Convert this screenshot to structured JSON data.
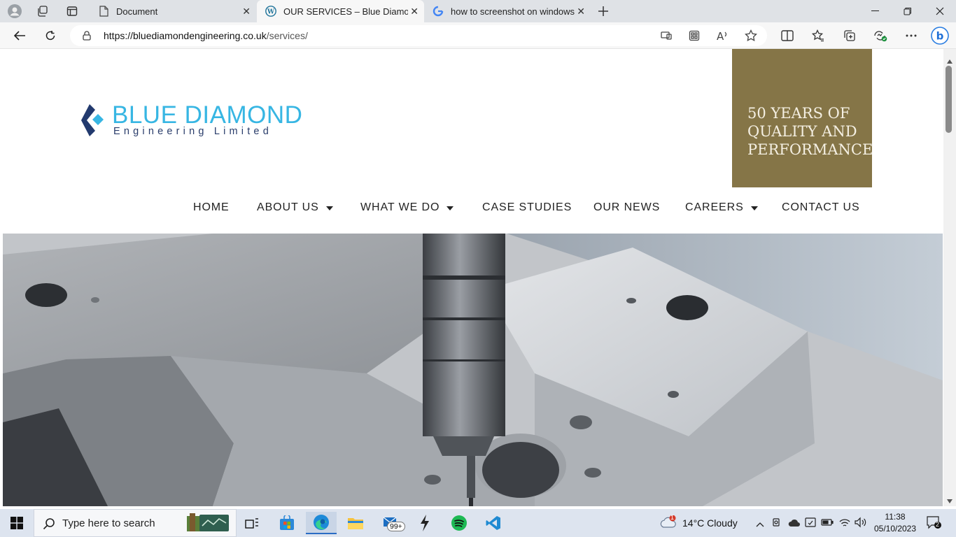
{
  "browser": {
    "tabs": [
      {
        "title": "Document"
      },
      {
        "title": "OUR SERVICES – Blue Diamond E"
      },
      {
        "title": "how to screenshot on windows -"
      }
    ],
    "url_host": "https://bluediamondengineering.co.uk",
    "url_path": "/services/",
    "icons": [
      "profile-icon",
      "workspaces-icon",
      "tab-actions-icon",
      "back-icon",
      "refresh-icon",
      "lock-icon",
      "app-available-icon",
      "extensions-icon",
      "read-aloud-icon",
      "favorite-star-icon",
      "split-screen-icon",
      "favorites-icon",
      "collections-icon",
      "browser-essentials-icon",
      "more-icon",
      "copilot-icon"
    ]
  },
  "site": {
    "logo": {
      "name": "BLUE DIAMOND",
      "subtitle": "Engineering Limited"
    },
    "promo": {
      "line1": "50 YEARS OF",
      "line2": "QUALITY AND",
      "line3": "PERFORMANCE"
    },
    "nav": [
      {
        "label": "HOME",
        "dropdown": false
      },
      {
        "label": "ABOUT US",
        "dropdown": true
      },
      {
        "label": "WHAT WE DO",
        "dropdown": true
      },
      {
        "label": "CASE STUDIES",
        "dropdown": false
      },
      {
        "label": "OUR NEWS",
        "dropdown": false
      },
      {
        "label": "CAREERS",
        "dropdown": true
      },
      {
        "label": "CONTACT US",
        "dropdown": false
      }
    ],
    "colors": {
      "brand_blue": "#37b6e3",
      "brand_navy": "#2a3d6b",
      "promo_bg": "#857547"
    }
  },
  "taskbar": {
    "search_placeholder": "Type here to search",
    "mail_badge": "99+",
    "weather_alert": "1",
    "weather": "14°C  Cloudy",
    "time": "11:38",
    "date": "05/10/2023",
    "notifications": "2"
  }
}
